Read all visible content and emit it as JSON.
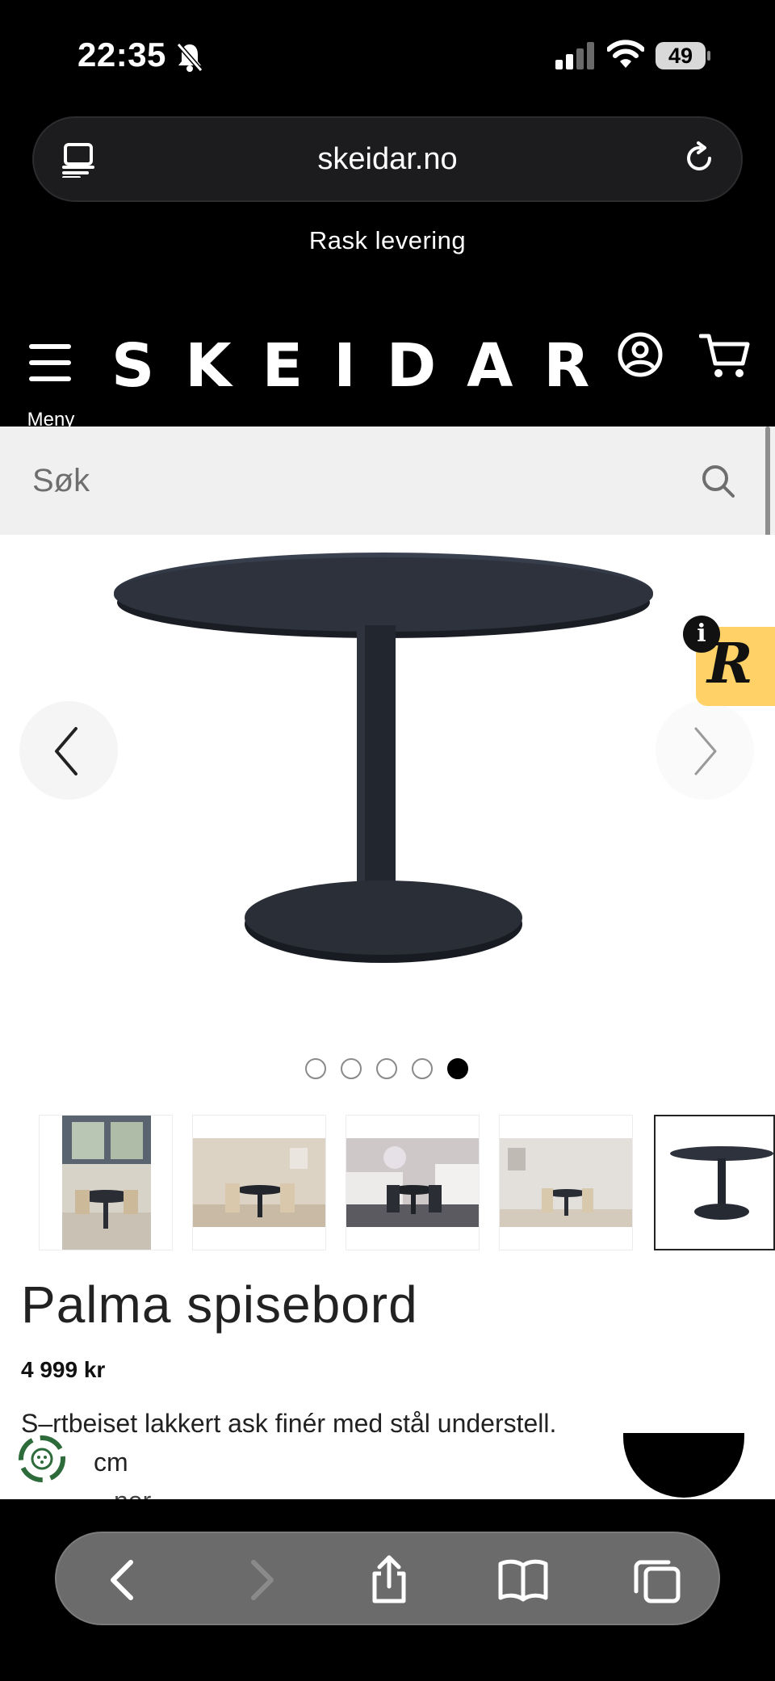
{
  "status_bar": {
    "time": "22:35",
    "battery": "49",
    "icons": [
      "bell-slash-icon",
      "cellular-signal-icon",
      "wifi-icon",
      "battery-icon"
    ]
  },
  "browser": {
    "url": "skeidar.no",
    "icons": [
      "tabs-overview-icon",
      "reload-icon"
    ]
  },
  "announcement": "Rask levering",
  "header": {
    "menu_label": "Meny",
    "logo": "SKEIDAR",
    "icons": [
      "account-icon",
      "cart-icon"
    ]
  },
  "search": {
    "placeholder": "Søk"
  },
  "carousel": {
    "slide_count": 5,
    "active_index": 4,
    "thumbnail_count": 5
  },
  "product": {
    "title": "Palma spisebord",
    "price": "4 999 kr",
    "desc_line1": "S–rtbeiset lakkert ask finér med stål understell.",
    "desc_line2": "cm",
    "desc_line3": "ner"
  },
  "colors": {
    "background": "#000000",
    "search_bg": "#f0f0f0",
    "badge_yellow": "#ffd166",
    "eco_green": "#2e6b3a"
  },
  "toolbar": {
    "icons": [
      "back-icon",
      "forward-icon",
      "share-icon",
      "bookmarks-icon",
      "tabs-icon"
    ]
  }
}
